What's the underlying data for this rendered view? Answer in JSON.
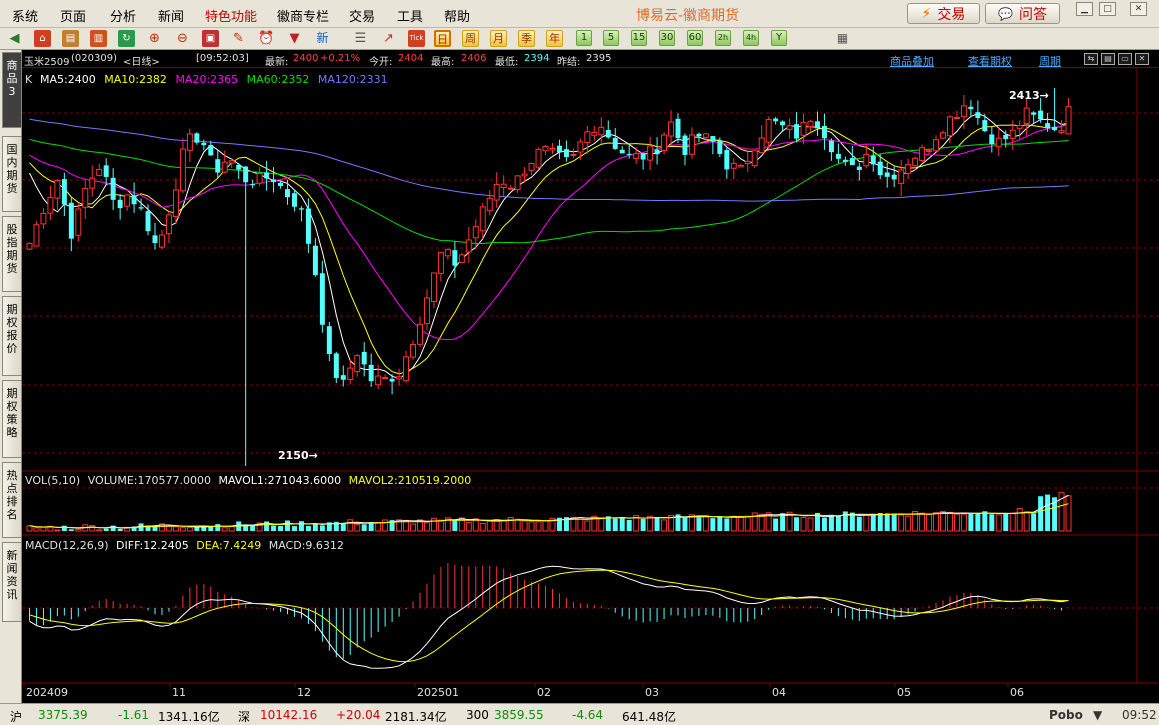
{
  "menu": {
    "items": [
      {
        "label": "系统",
        "special": false
      },
      {
        "label": "页面",
        "special": false
      },
      {
        "label": "分析",
        "special": false
      },
      {
        "label": "新闻",
        "special": false
      },
      {
        "label": "特色功能",
        "special": true
      },
      {
        "label": "徽商专栏",
        "special": false
      },
      {
        "label": "交易",
        "special": false
      },
      {
        "label": "工具",
        "special": false
      },
      {
        "label": "帮助",
        "special": false
      }
    ],
    "app_title": "博易云-徽商期货",
    "trade_button": "交易",
    "qa_button": "问答"
  },
  "toolbar": {
    "period_number_buttons": [
      "1",
      "5",
      "15",
      "30",
      "60"
    ],
    "period_cn_buttons": [
      "日",
      "周",
      "月",
      "季",
      "年"
    ],
    "period_hour_buttons": [
      "2h",
      "4h"
    ],
    "period_year_button": "Y",
    "tick_label": "Tick",
    "news_label": "新"
  },
  "sidebar": {
    "tabs": [
      {
        "label": "商品3",
        "active": true
      },
      {
        "label": "国内期货",
        "active": false
      },
      {
        "label": "股指期货",
        "active": false
      },
      {
        "label": "期权报价",
        "active": false
      },
      {
        "label": "期权策略",
        "active": false
      },
      {
        "label": "热点排名",
        "active": false
      },
      {
        "label": "新闻资讯",
        "active": false
      }
    ]
  },
  "quote": {
    "symbol": "玉米2509",
    "code": "(020309)",
    "period": "<日线>",
    "time": "[09:52:03]",
    "last_label": "最新:",
    "last": "2400",
    "change_pct": "+0.21%",
    "open_label": "今开:",
    "open": "2404",
    "high_label": "最高:",
    "high": "2406",
    "low_label": "最低:",
    "low": "2394",
    "prev_close_label": "昨结:",
    "prev_close": "2395",
    "links": [
      "商品叠加",
      "查看期权",
      "周期"
    ]
  },
  "main_panel": {
    "k_label": "K",
    "ma": [
      {
        "label": "MA5:2400",
        "color": "#ffffff"
      },
      {
        "label": "MA10:2382",
        "color": "#ffff00"
      },
      {
        "label": "MA20:2365",
        "color": "#ff00ff"
      },
      {
        "label": "MA60:2352",
        "color": "#00dd00"
      },
      {
        "label": "MA120:2331",
        "color": "#7777ff"
      }
    ],
    "high_marker": "2413→",
    "low_marker": "2150→"
  },
  "volume_panel": {
    "label": "VOL(5,10)",
    "volume": "VOLUME:170577.0000",
    "mavol1": "MAVOL1:271043.6000",
    "mavol2": "MAVOL2:210519.2000"
  },
  "macd_panel": {
    "label": "MACD(12,26,9)",
    "diff": "DIFF:12.2405",
    "dea": "DEA:7.4249",
    "macd": "MACD:9.6312"
  },
  "x_axis": {
    "labels": [
      "202409",
      "11",
      "12",
      "202501",
      "02",
      "03",
      "04",
      "05",
      "06"
    ]
  },
  "status": {
    "sh_label": "沪",
    "sh_index": "3375.39",
    "sh_change": "-1.61",
    "sh_amount": "1341.16亿",
    "sz_label": "深",
    "sz_index": "10142.16",
    "sz_change": "+20.04",
    "sz_amount": "2181.34亿",
    "c300_label": "300",
    "c300_index": "3859.55",
    "c300_change": "-4.64",
    "c300_amount": "641.48亿",
    "brand": "Pobo",
    "clock": "09:52"
  },
  "colors": {
    "up": "#ff3232",
    "down": "#54ffff",
    "grid": "#800000",
    "bg": "#000000"
  },
  "chart_data": {
    "type": "candlestick",
    "y_range": [
      2150,
      2413
    ],
    "high_point": 2413,
    "low_point": 2150,
    "current": {
      "last": 2400,
      "open": 2404,
      "high": 2406,
      "low": 2394
    },
    "moving_averages": {
      "MA5": 2400,
      "MA10": 2382,
      "MA20": 2365,
      "MA60": 2352,
      "MA120": 2331
    },
    "volume": {
      "VOLUME": 170577,
      "MAVOL1": 271043.6,
      "MAVOL2": 210519.2
    },
    "macd": {
      "DIFF": 12.2405,
      "DEA": 7.4249,
      "MACD": 9.6312
    },
    "x_labels": [
      "202409",
      "11",
      "12",
      "202501",
      "02",
      "03",
      "04",
      "05",
      "06"
    ],
    "close_path": [
      2305,
      2330,
      2350,
      2310,
      2345,
      2360,
      2330,
      2340,
      2325,
      2300,
      2335,
      2375,
      2380,
      2355,
      2365,
      2350,
      2348,
      2352,
      2340,
      2330,
      2290,
      2225,
      2205,
      2230,
      2210,
      2210,
      2215,
      2240,
      2270,
      2300,
      2290,
      2310,
      2330,
      2350,
      2345,
      2360,
      2370,
      2365,
      2360,
      2380,
      2390,
      2375,
      2365,
      2365,
      2370,
      2390,
      2370,
      2380,
      2375,
      2360,
      2355,
      2375,
      2390,
      2385,
      2380,
      2395,
      2380,
      2360,
      2355,
      2370,
      2350,
      2355,
      2365,
      2370,
      2385,
      2395,
      2405,
      2385,
      2375,
      2380,
      2395,
      2390,
      2385,
      2390
    ]
  }
}
